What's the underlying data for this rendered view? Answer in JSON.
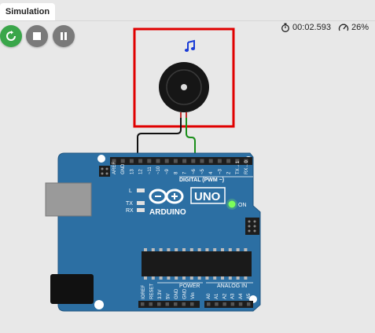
{
  "tab": {
    "label": "Simulation"
  },
  "controls": {
    "restart": "restart-icon",
    "stop": "stop-icon",
    "pause": "pause-icon"
  },
  "status": {
    "timer": "00:02.593",
    "speed": "26%"
  },
  "buzzer": {
    "note_icon": "music-note-icon"
  },
  "board": {
    "brand": "ARDUINO",
    "model": "UNO",
    "digital_label": "DIGITAL (PWM ~)",
    "power_label": "POWER",
    "analog_label": "ANALOG IN",
    "on_label": "ON",
    "l_label": "L",
    "tx_label": "TX",
    "rx_label": "RX",
    "digital_pins": [
      "AREF",
      "GND",
      "13",
      "12",
      "~11",
      "~10",
      "~9",
      "8",
      "7",
      "~6",
      "~5",
      "4",
      "~3",
      "2",
      "TX→1",
      "RX←0"
    ],
    "power_pins": [
      "IOREF",
      "RESET",
      "3.3V",
      "5V",
      "GND",
      "GND",
      "Vin"
    ],
    "analog_pins": [
      "A0",
      "A1",
      "A2",
      "A3",
      "A4",
      "A5"
    ]
  },
  "colors": {
    "board": "#2c6fa3",
    "highlight_box": "#e00000",
    "restart_button": "#3aa64a",
    "wire_ground": "#111111",
    "wire_signal": "#1a8f1a",
    "on_led": "#7dff5a"
  }
}
